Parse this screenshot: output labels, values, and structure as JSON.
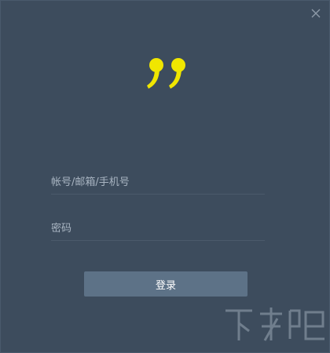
{
  "window": {
    "close_icon": "close-icon",
    "logo_icon": "quote-mark-logo",
    "accent_color": "#f0e600",
    "background_color": "#3d4c5d"
  },
  "form": {
    "account_placeholder": "帐号/邮箱/手机号",
    "password_placeholder": "密码",
    "login_label": "登录"
  },
  "watermark": {
    "icon": "watermark-logo"
  }
}
